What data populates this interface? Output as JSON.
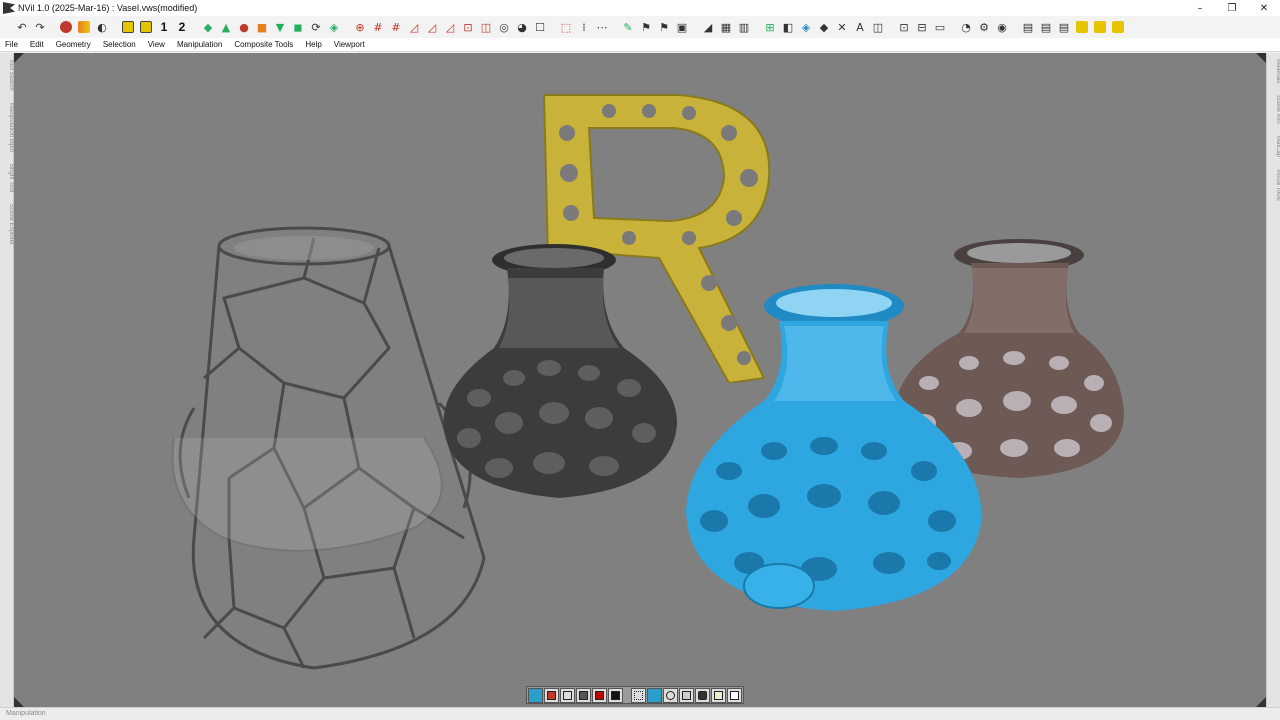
{
  "window": {
    "title": "NVil 1.0 (2025-Mar-16) : VaseI.vws(modified)",
    "controls": [
      "minimize-icon",
      "restore-icon",
      "close-icon"
    ]
  },
  "toolbar": {
    "view_numbers": [
      "1",
      "2"
    ],
    "icons": [
      "undo-icon",
      "redo-icon",
      "object-mode-icon",
      "color-picker-icon",
      "mirror-icon",
      "grid-snap-icon",
      "select-icon",
      "move-icon",
      "rotate-icon",
      "scale-icon",
      "bevel-icon",
      "extrude-icon",
      "loop-icon",
      "cut-icon",
      "knife-icon",
      "smooth-icon",
      "subdivide-icon",
      "render-icon",
      "material-icon",
      "save-icon"
    ]
  },
  "menu": {
    "items": [
      "File",
      "Edit",
      "Geometry",
      "Selection",
      "View",
      "Manipulation",
      "Composite Tools",
      "Help",
      "Viewport"
    ]
  },
  "left_panel": {
    "tabs": [
      "Tool Search",
      "Manipulation Input",
      "Bright Tool",
      "Scene Explorer"
    ]
  },
  "right_panel": {
    "tabs": [
      "Materials",
      "Scene Info",
      "MatCap",
      "Visual Tools"
    ]
  },
  "viewport": {
    "background": "#808080",
    "objects": [
      "wireframe-vase",
      "dark-voronoi-vase",
      "gold-letter-r",
      "blue-voronoi-vase",
      "bronze-voronoi-vase"
    ],
    "colors": {
      "gold": "#c9b23a",
      "blue": "#2ea6e0",
      "dark": "#3a3a3a",
      "bronze": "#6e5a55",
      "wire": "#555555"
    }
  },
  "viewport_toolbar": {
    "buttons": [
      "perspective-icon",
      "shaded-cube-icon",
      "wire-cube-icon",
      "solid-cube-icon",
      "red-cube-icon",
      "black-cube-icon",
      "grid-icon",
      "matcap-icon",
      "gear-icon",
      "light-icon",
      "camera-icon",
      "screenshot-icon",
      "trash-icon"
    ]
  },
  "status": {
    "text": "Manipulation"
  }
}
